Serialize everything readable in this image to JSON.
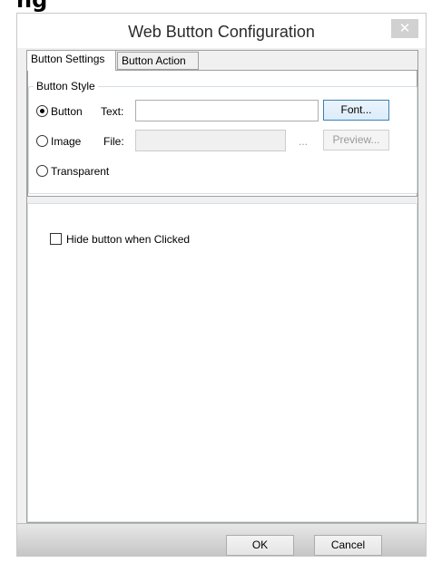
{
  "background_fragment": "ng",
  "window": {
    "title": "Web Button Configuration",
    "close_glyph": "✕"
  },
  "tabs": [
    {
      "label": "Button Settings",
      "active": true
    },
    {
      "label": "Button Action",
      "active": false
    }
  ],
  "button_style": {
    "legend": "Button Style",
    "options": [
      {
        "label": "Button",
        "selected": true
      },
      {
        "label": "Image",
        "selected": false
      },
      {
        "label": "Transparent",
        "selected": false
      }
    ],
    "text_label": "Text:",
    "text_value": "",
    "font_button": "Font...",
    "file_label": "File:",
    "file_value": "",
    "ellipsis": "...",
    "preview_button": "Preview..."
  },
  "hide_checkbox": {
    "label": "Hide button when Clicked",
    "checked": false
  },
  "footer": {
    "ok": "OK",
    "cancel": "Cancel"
  }
}
